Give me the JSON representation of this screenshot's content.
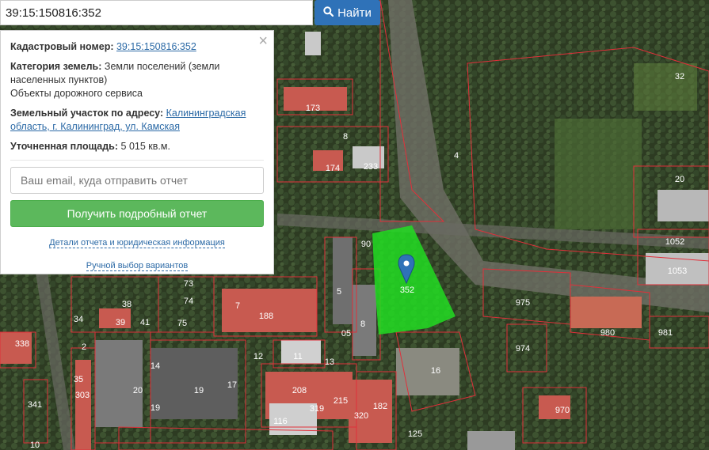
{
  "search": {
    "value": "39:15:150816:352",
    "button_label": "Найти"
  },
  "panel": {
    "cadastral_label": "Кадастровый номер:",
    "cadastral_value": "39:15:150816:352",
    "category_label": "Категория земель:",
    "category_value": "Земли поселений (земли населенных пунктов)",
    "category_extra": "Объекты дорожного сервиса",
    "address_label": "Земельный участок по адресу:",
    "address_value": "Калининградская область, г. Калининград, ул. Камская",
    "area_label": "Уточненная площадь:",
    "area_value": "5 015 кв.м.",
    "email_placeholder": "Ваш email, куда отправить отчет",
    "report_button": "Получить подробный отчет",
    "details_link": "Детали отчета и юридическая информация",
    "manual_link": "Ручной выбор вариантов"
  },
  "map": {
    "parcel_numbers": [
      "173",
      "8",
      "174",
      "233",
      "4",
      "32",
      "20",
      "1052",
      "1053",
      "975",
      "980",
      "981",
      "974",
      "970",
      "16",
      "73",
      "74",
      "75",
      "38",
      "39",
      "41",
      "7",
      "188",
      "5",
      "8",
      "12",
      "11",
      "13",
      "338",
      "341",
      "303",
      "35",
      "34",
      "20",
      "19",
      "17",
      "14",
      "19",
      "208",
      "215",
      "319",
      "116",
      "320",
      "182",
      "125",
      "10",
      "05",
      "90",
      "2",
      "352"
    ],
    "colors": {
      "selected_parcel": "#22dd22",
      "parcel_border": "#e0303a",
      "building_roof": "#d9534f",
      "marker": "#2f72b8"
    }
  }
}
